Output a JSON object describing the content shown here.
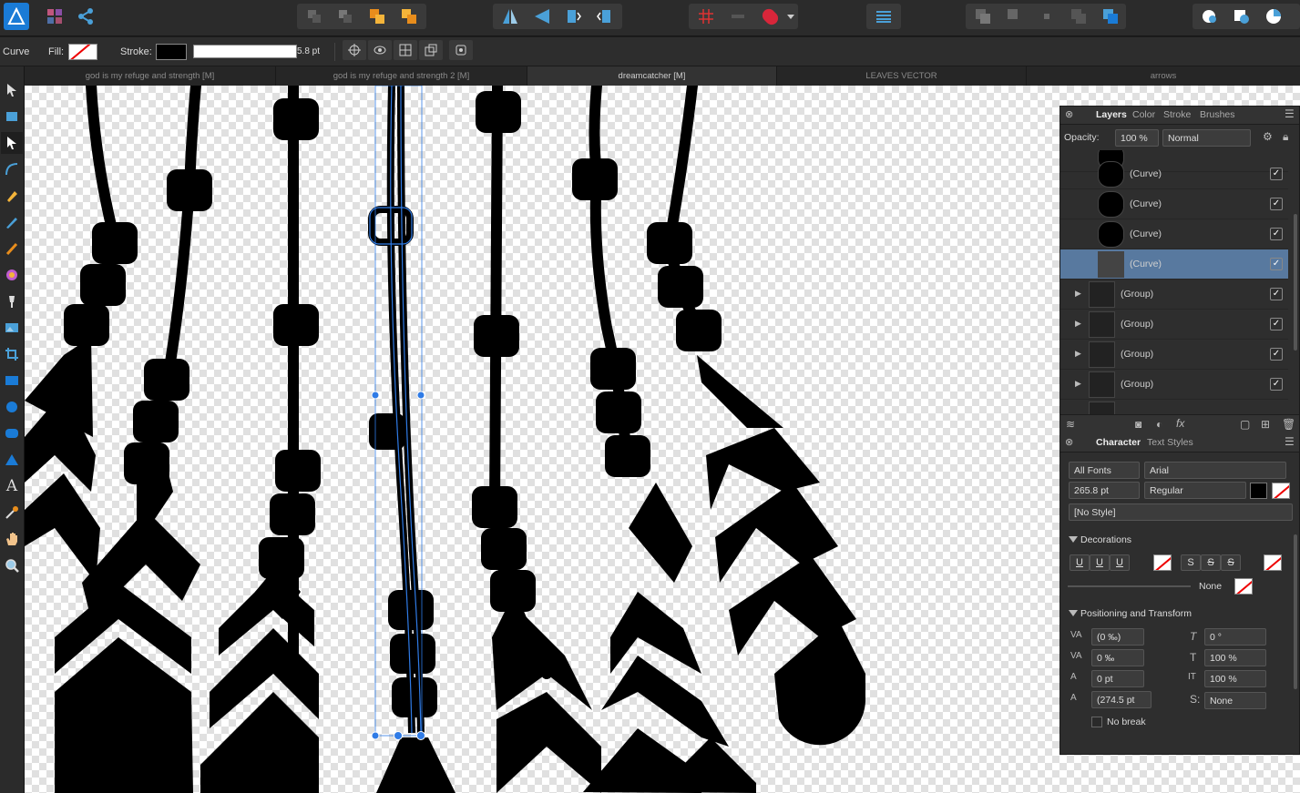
{
  "context_bar": {
    "tool_name": "Curve",
    "fill_label": "Fill:",
    "stroke_label": "Stroke:",
    "stroke_width": "5.8 pt"
  },
  "document_tabs": [
    {
      "label": "god is my refuge and strength [M]",
      "active": false
    },
    {
      "label": "god is my refuge and strength 2 [M]",
      "active": false
    },
    {
      "label": "dreamcatcher [M]",
      "active": true
    },
    {
      "label": "LEAVES VECTOR",
      "active": false
    },
    {
      "label": "arrows",
      "active": false
    }
  ],
  "layers_panel": {
    "tabs": [
      "Layers",
      "Color",
      "Stroke",
      "Brushes"
    ],
    "opacity_label": "Opacity:",
    "opacity_value": "100 %",
    "blend_mode": "Normal",
    "items": [
      {
        "name": "(Curve)",
        "selected": false,
        "visible": true
      },
      {
        "name": "(Curve)",
        "selected": false,
        "visible": true
      },
      {
        "name": "(Curve)",
        "selected": false,
        "visible": true
      },
      {
        "name": "(Curve)",
        "selected": true,
        "visible": true
      },
      {
        "name": "(Group)",
        "selected": false,
        "visible": true
      },
      {
        "name": "(Group)",
        "selected": false,
        "visible": true
      },
      {
        "name": "(Group)",
        "selected": false,
        "visible": true
      },
      {
        "name": "(Group)",
        "selected": false,
        "visible": true
      }
    ]
  },
  "character_panel": {
    "tabs": [
      "Character",
      "Text Styles"
    ],
    "font_collection": "All Fonts",
    "font_family": "Arial",
    "font_size": "265.8 pt",
    "font_style": "Regular",
    "text_style": "[No Style]",
    "decorations_title": "Decorations",
    "underline_none_label": "None",
    "positioning_title": "Positioning and Transform",
    "tracking": "(0 ‰)",
    "kerning": "0 ‰",
    "baseline": "0 pt",
    "leading": "(274.5 pt",
    "shear": "0 °",
    "vertical_scale": "100 %",
    "horizontal_scale": "100 %",
    "superscript_mode": "None",
    "no_break_label": "No break"
  },
  "colors": {
    "accent": "#58799f",
    "selection_blue": "#2f7be6"
  }
}
